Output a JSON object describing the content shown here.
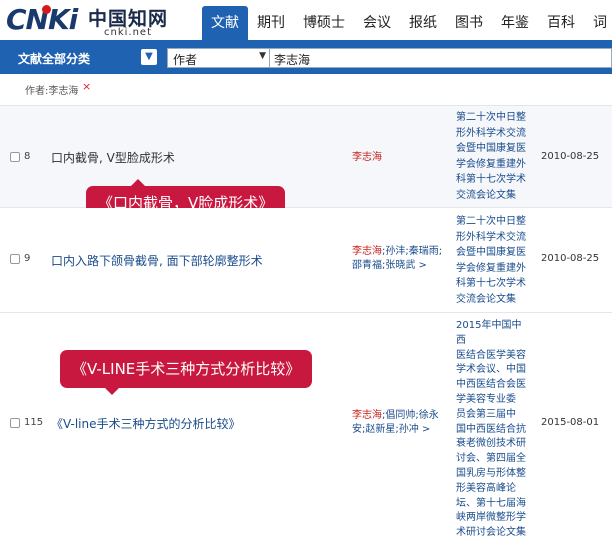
{
  "logo": {
    "brand": "CNKi",
    "chinese": "中国知网",
    "url": "cnki.net"
  },
  "nav": [
    "文献",
    "期刊",
    "博硕士",
    "会议",
    "报纸",
    "图书",
    "年鉴",
    "百科",
    "词"
  ],
  "search": {
    "scope": "文献全部分类",
    "field": "作者",
    "query": "李志海"
  },
  "filter": {
    "tag": "作者:李志海",
    "remove": "×"
  },
  "results": [
    {
      "num": "8",
      "title": "口内截骨, V型脸成形术",
      "author_main": "李志海",
      "author_rest": "",
      "source_lines": [
        "第二十次中日整",
        "形外科学术交流",
        "会暨中国康复医",
        "学会修复重建外",
        "科第十七次学术",
        "交流会论文集"
      ],
      "date": "2010-08-25"
    },
    {
      "num": "9",
      "title": "口内入路下颌骨截骨, 面下部轮廓整形术",
      "author_main": "李志海",
      "author_rest": ";孙沣;秦瑞雨;邵青福;张晓武 >",
      "source_lines": [
        "第二十次中日整",
        "形外科学术交流",
        "会暨中国康复医",
        "学会修复重建外",
        "科第十七次学术",
        "交流会论文集"
      ],
      "date": "2010-08-25"
    },
    {
      "num": "115",
      "title": "《V-line手术三种方式的分析比较》",
      "author_main": "李志海",
      "author_rest": ";倡同帅;徐永安;赵新星;孙冲 >",
      "source_lines": [
        "2015年中国中西",
        "医结合医学美容",
        "学术会议、中国",
        "中西医结合会医",
        "学美容专业委",
        "员会第三届中",
        "国中西医结合抗",
        "衰老微创技术研",
        "讨会、第四届全",
        "国乳房与形体整",
        "形美容高峰论",
        "坛、第十七届海",
        "峡两岸微整形学",
        "术研讨会论文集"
      ],
      "date": "2015-08-01"
    }
  ],
  "callouts": [
    "《口内截骨，V脸成形术》",
    "《V-LINE手术三种方式分析比较》"
  ]
}
